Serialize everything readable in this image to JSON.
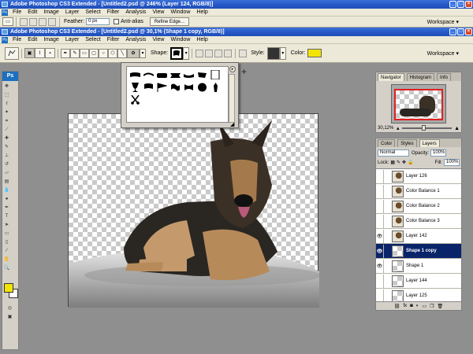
{
  "outer_window": {
    "title": "Adobe Photoshop CS3 Extended - [Untitled2.psd @ 246% (Layer 124, RGB/8)]"
  },
  "outer_menu": [
    "File",
    "Edit",
    "Image",
    "Layer",
    "Select",
    "Filter",
    "Analysis",
    "View",
    "Window",
    "Help"
  ],
  "outer_options": {
    "feather_label": "Feather:",
    "feather_value": "0 px",
    "antialias_label": "Anti-alias",
    "refine_label": "Refine Edge...",
    "workspace_label": "Workspace ▾"
  },
  "inner_window": {
    "title": "Adobe Photoshop CS3 Extended - [Untitled2.psd @ 30,1% (Shape 1 copy, RGB/8)]"
  },
  "inner_menu": [
    "File",
    "Edit",
    "Image",
    "Layer",
    "Select",
    "Filter",
    "Analysis",
    "View",
    "Window",
    "Help"
  ],
  "options": {
    "shape_label": "Shape:",
    "style_label": "Style:",
    "color_label": "Color:",
    "workspace_label": "Workspace ▾",
    "color": "#f2e400"
  },
  "ps_logo": "Ps",
  "navigator": {
    "tabs": [
      "Navigator",
      "Histogram",
      "Info"
    ],
    "zoom": "30,12%"
  },
  "layers_panel": {
    "tabs": [
      "Color",
      "Styles",
      "Layers"
    ],
    "blend_mode": "Normal",
    "opacity_label": "Opacity:",
    "opacity_value": "100%",
    "lock_label": "Lock:",
    "fill_label": "Fill:",
    "fill_value": "100%",
    "rows": [
      {
        "name": "Layer 126",
        "eye": false,
        "selected": false,
        "thumb": "dog"
      },
      {
        "name": "Color Balance 1",
        "eye": false,
        "selected": false,
        "thumb": "dog"
      },
      {
        "name": "Color Balance 2",
        "eye": false,
        "selected": false,
        "thumb": "dog"
      },
      {
        "name": "Color Balance 3",
        "eye": false,
        "selected": false,
        "thumb": "dog"
      },
      {
        "name": "Layer 142",
        "eye": true,
        "selected": false,
        "thumb": "dog"
      },
      {
        "name": "Shape 1 copy",
        "eye": true,
        "selected": true,
        "thumb": "checker"
      },
      {
        "name": "Shape 1",
        "eye": true,
        "selected": false,
        "thumb": "checker"
      },
      {
        "name": "Layer 144",
        "eye": false,
        "selected": false,
        "thumb": "checker"
      },
      {
        "name": "Layer 125",
        "eye": false,
        "selected": false,
        "thumb": "checker"
      }
    ],
    "footer_icons": [
      "link-icon",
      "fx-icon",
      "mask-icon",
      "adjustment-icon",
      "folder-icon",
      "new-layer-icon",
      "trash-icon"
    ]
  },
  "toolbox": {
    "foreground": "#f2e400",
    "background": "#ffffff"
  },
  "shape_picker": {
    "shapes": [
      "banner-1",
      "banner-2",
      "banner-3",
      "banner-4",
      "banner-5",
      "banner-6",
      "blank",
      "trophy",
      "ribbon",
      "flag-1",
      "flag-2",
      "flag-3",
      "seal",
      "ornament",
      "scissors"
    ]
  }
}
